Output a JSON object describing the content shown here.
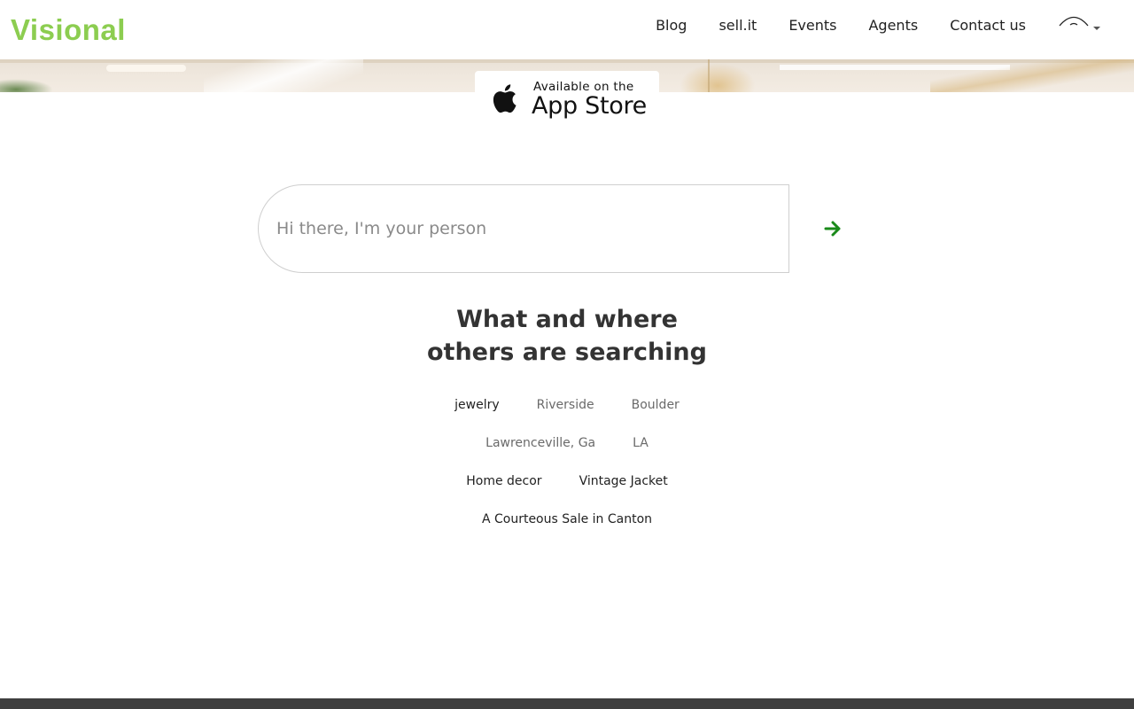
{
  "brand": {
    "name": "Visional",
    "color": "#8ccd50"
  },
  "nav": {
    "links": [
      "Blog",
      "sell.it",
      "Events",
      "Agents",
      "Contact us"
    ]
  },
  "app_store": {
    "small_text": "Available on the",
    "big_text": "App Store"
  },
  "search": {
    "placeholder": "Hi there, I'm your person",
    "value": "",
    "submit_icon": "arrow-right-icon",
    "accent": "#1a8a1a"
  },
  "section": {
    "heading_line1": "What and where",
    "heading_line2": "others are searching"
  },
  "tags": [
    [
      "jewelry",
      "Riverside",
      "Boulder"
    ],
    [
      "Lawrenceville, Ga",
      "LA"
    ],
    [
      "Home decor",
      "Vintage Jacket"
    ],
    [
      "A Courteous Sale in Canton"
    ]
  ]
}
